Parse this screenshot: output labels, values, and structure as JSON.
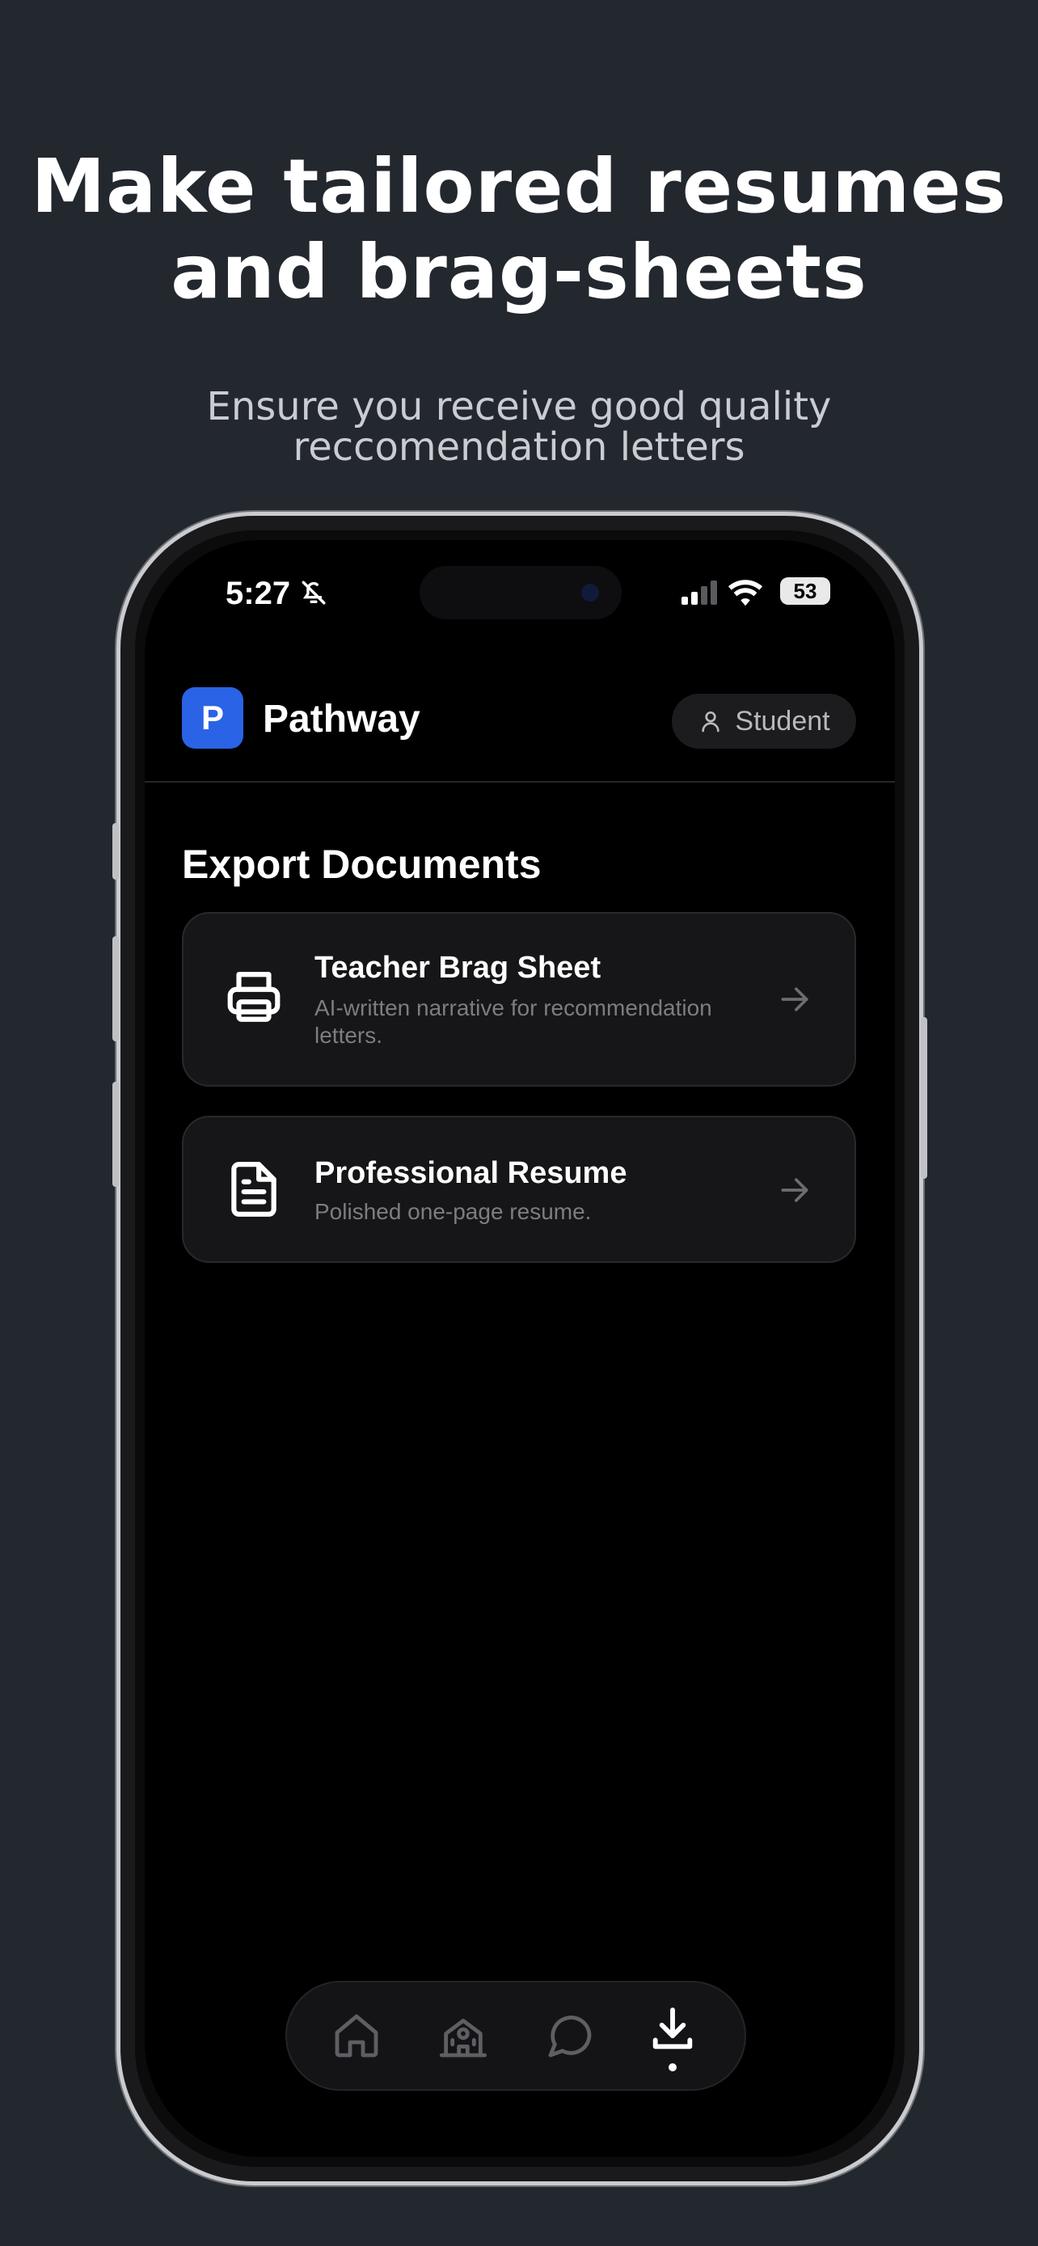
{
  "promo": {
    "headline_line1": "Make tailored resumes",
    "headline_line2": "and brag-sheets",
    "subline_line1": "Ensure you receive good quality",
    "subline_line2": "reccomendation letters"
  },
  "status_bar": {
    "time": "5:27",
    "battery": "53"
  },
  "header": {
    "logo_letter": "P",
    "app_name": "Pathway",
    "role_label": "Student"
  },
  "main": {
    "section_title": "Export Documents",
    "documents": [
      {
        "title": "Teacher Brag Sheet",
        "description": "AI-written narrative for recommendation letters.",
        "icon": "printer-icon"
      },
      {
        "title": "Professional Resume",
        "description": "Polished one-page resume.",
        "icon": "document-icon"
      }
    ]
  },
  "tab_bar": {
    "tabs": [
      {
        "icon": "home-icon",
        "active": false
      },
      {
        "icon": "school-icon",
        "active": false
      },
      {
        "icon": "chat-bubble-icon",
        "active": false
      },
      {
        "icon": "download-icon",
        "active": true
      }
    ]
  },
  "colors": {
    "background": "#23272e",
    "accent": "#2a63e6",
    "card": "#161618"
  }
}
